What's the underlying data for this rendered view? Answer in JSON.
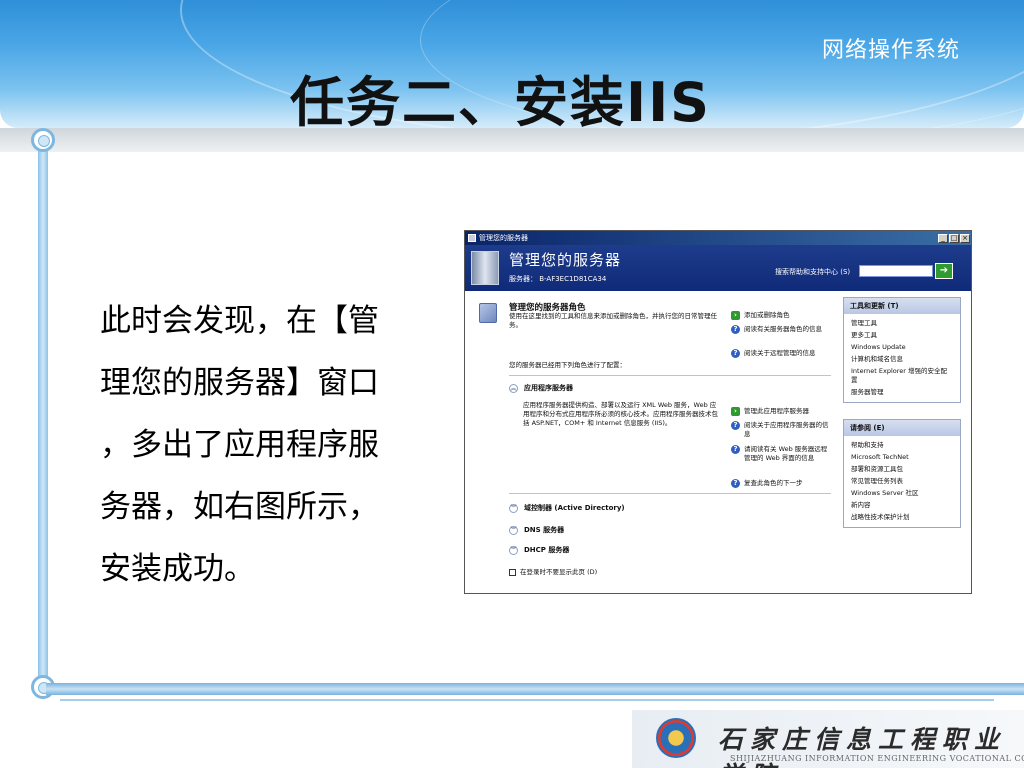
{
  "slide": {
    "course_name": "网络操作系统",
    "title": "任务二、安装IIS",
    "body_lines": [
      "此时会发现，在【管",
      "理您的服务器】窗口",
      "，多出了应用程序服",
      "务器，如右图所示，",
      "安装成功。"
    ],
    "footer_college_cn": "石家庄信息工程职业学院",
    "footer_college_en": "SHIJIAZHUANG INFORMATION ENGINEERING VOCATIONAL COLLEGE"
  },
  "window": {
    "titlebar_text": "管理您的服务器",
    "titlebar_buttons": [
      "_",
      "□",
      "×"
    ],
    "header": {
      "title": "管理您的服务器",
      "server_label": "服务器： B-AF3EC1D81CA34",
      "search_label": "搜索帮助和支持中心 (S)",
      "search_value": "",
      "go_icon": "arrow-right-icon"
    },
    "roles": {
      "title": "管理您的服务器角色",
      "description": "使用在这里找到的工具和信息来添加或删除角色，并执行您的日常管理任务。",
      "actions": [
        {
          "icon": "arrow",
          "label": "添加或删除角色"
        },
        {
          "icon": "help",
          "label": "阅读有关服务器角色的信息"
        },
        {
          "icon": "help",
          "label": "阅读关于远程管理的信息"
        }
      ],
      "configured_intro": "您的服务器已经用下列角色进行了配置："
    },
    "app_server": {
      "label": "应用程序服务器",
      "description": "应用程序服务器提供构造、部署以及运行 XML Web 服务，Web 应用程序和分布式应用程序所必须的核心技术。应用程序服务器技术包括 ASP.NET，COM+ 和 Internet 信息服务 (IIS)。",
      "actions": [
        {
          "icon": "arrow",
          "label": "管理此应用程序服务器"
        },
        {
          "icon": "help",
          "label": "阅读关于应用程序服务器的信息"
        },
        {
          "icon": "help",
          "label": "请阅读有关 Web 服务器远程管理的 Web 界面的信息"
        },
        {
          "icon": "help",
          "label": "复查此角色的下一步"
        }
      ]
    },
    "other_roles": [
      "域控制器 (Active Directory)",
      "DNS 服务器",
      "DHCP 服务器"
    ],
    "checkbox_label": "在登录时不要显示此页 (D)",
    "panels": [
      {
        "title": "工具和更新 (T)",
        "items": [
          "管理工具",
          "更多工具",
          "Windows Update",
          "计算机和域名信息",
          "Internet Explorer 增强的安全配置",
          "服务器管理"
        ]
      },
      {
        "title": "请参阅 (E)",
        "items": [
          "帮助和支持",
          "Microsoft TechNet",
          "部署和资源工具包",
          "常见管理任务列表",
          "Windows Server 社区",
          "新内容",
          "战略性技术保护计划"
        ]
      }
    ]
  }
}
